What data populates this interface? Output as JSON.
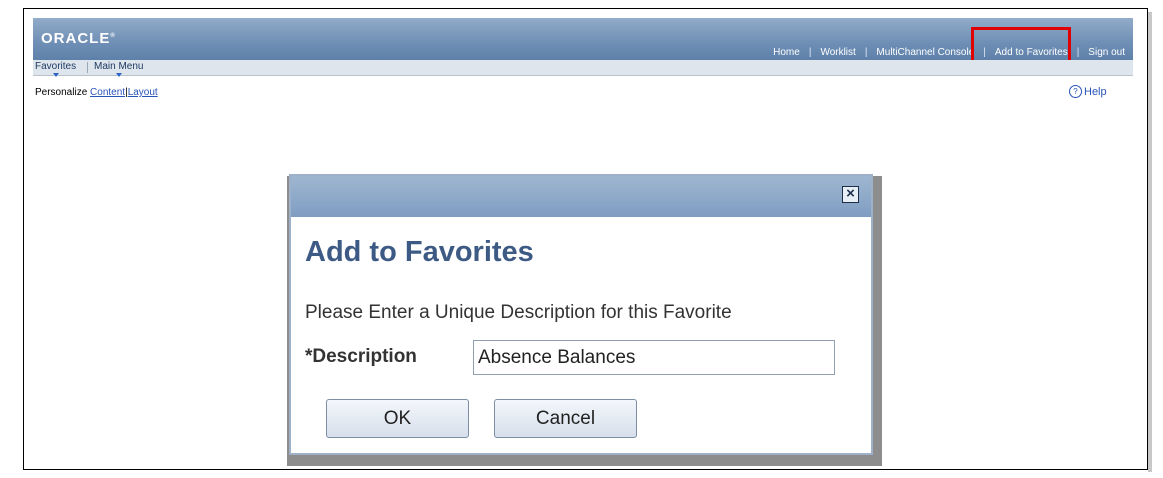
{
  "header": {
    "logo": "ORACLE",
    "links": [
      "Home",
      "Worklist",
      "MultiChannel Console",
      "Add to Favorites",
      "Sign out"
    ]
  },
  "nav": {
    "favorites": "Favorites",
    "main_menu": "Main Menu"
  },
  "personalize": {
    "label": "Personalize",
    "content": "Content",
    "separator": "|",
    "layout": "Layout"
  },
  "help": {
    "icon": "?",
    "label": "Help"
  },
  "modal": {
    "close": "×",
    "title": "Add to Favorites",
    "instruction": "Please Enter a Unique Description for this Favorite",
    "description_label": "*Description",
    "description_value": "Absence Balances",
    "ok": "OK",
    "cancel": "Cancel"
  },
  "colors": {
    "banner": "#6f8fb5",
    "highlight": "#e00000",
    "heading": "#3d5a85",
    "link": "#2a53b8"
  }
}
